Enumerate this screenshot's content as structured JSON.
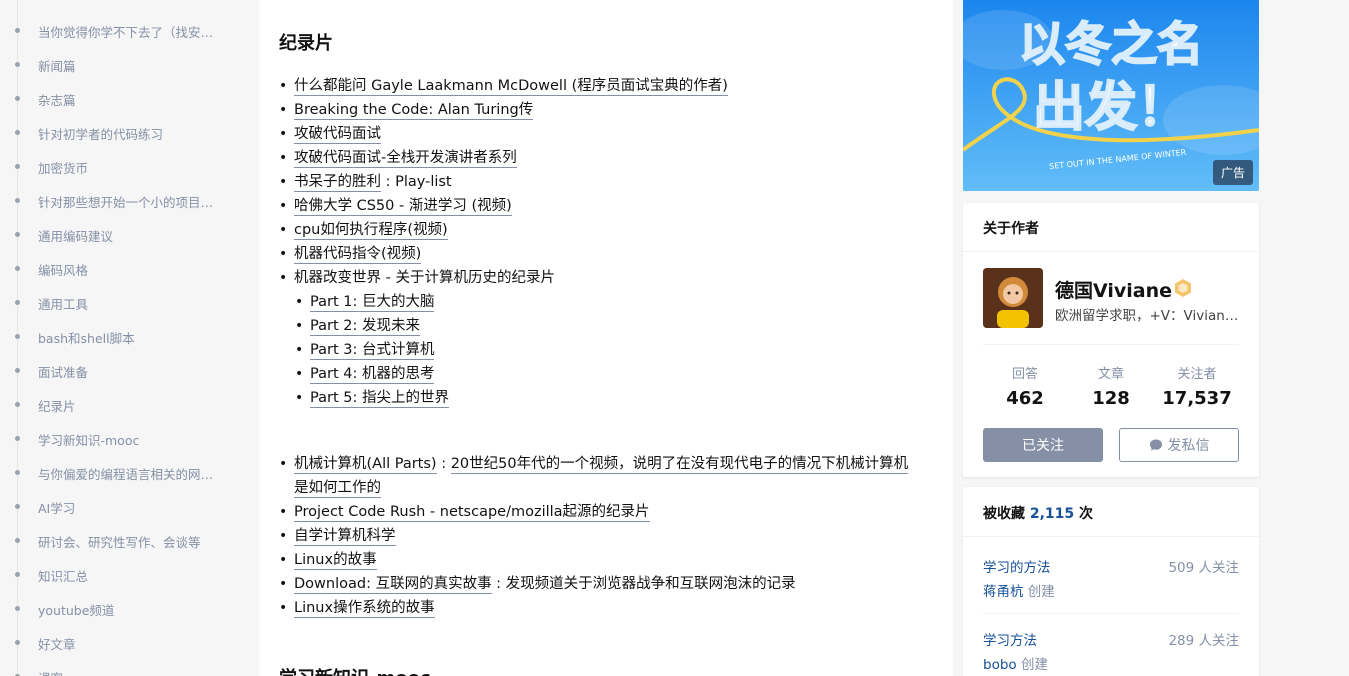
{
  "catalog": {
    "items": [
      {
        "label": "当你觉得你学不下去了（找安慰..."
      },
      {
        "label": "新闻篇"
      },
      {
        "label": "杂志篇"
      },
      {
        "label": "针对初学者的代码练习"
      },
      {
        "label": "加密货币"
      },
      {
        "label": "针对那些想开始一个小的项目但..."
      },
      {
        "label": "通用编码建议"
      },
      {
        "label": "编码风格"
      },
      {
        "label": "通用工具"
      },
      {
        "label": "bash和shell脚本"
      },
      {
        "label": "面试准备"
      },
      {
        "label": "纪录片"
      },
      {
        "label": "学习新知识-mooc"
      },
      {
        "label": "与你偏爱的编程语言相关的网站..."
      },
      {
        "label": "AI学习"
      },
      {
        "label": "研讨会、研究性写作、会谈等"
      },
      {
        "label": "知识汇总"
      },
      {
        "label": "youtube频道"
      },
      {
        "label": "好文章"
      },
      {
        "label": "课客"
      }
    ]
  },
  "article": {
    "section_title": "纪录片",
    "next_section_title": "学习新知识-mooc",
    "list1": [
      {
        "link": "什么都能问 Gayle Laakmann McDowell (程序员面试宝典的作者)",
        "rest": ""
      },
      {
        "link": "Breaking the Code: Alan Turing传",
        "rest": ""
      },
      {
        "link": "攻破代码面试",
        "rest": ""
      },
      {
        "link": "攻破代码面试-全栈开发演讲者系列",
        "rest": ""
      },
      {
        "link": "书呆子的胜利",
        "rest": " : Play-list"
      },
      {
        "link": "哈佛大学 CS50 - 渐进学习 (视频)",
        "rest": ""
      },
      {
        "link": "cpu如何执行程序(视频)",
        "rest": ""
      },
      {
        "link": "机器代码指令(视频)",
        "rest": ""
      }
    ],
    "list1_text_item": "机器改变世界 - 关于计算机历史的纪录片",
    "sublist": [
      {
        "link": "Part 1: 巨大的大脑"
      },
      {
        "link": "Part 2: 发现未来"
      },
      {
        "link": "Part 3: 台式计算机"
      },
      {
        "link": "Part 4: 机器的思考"
      },
      {
        "link": "Part 5: 指尖上的世界"
      }
    ],
    "list2_first": {
      "link": "机械计算机(All Parts)",
      "rest": " : ",
      "link2a": "20世纪50年代的一个视频，说明了在没有现代电子的情况下机械计算机",
      "link2b": "是如何工作的"
    },
    "list2": [
      {
        "link": "Project Code Rush - netscape/mozilla起源的纪录片",
        "rest": ""
      },
      {
        "link": "自学计算机科学",
        "rest": ""
      },
      {
        "link": "Linux的故事",
        "rest": ""
      },
      {
        "link": "Download: 互联网的真实故事",
        "rest": " : 发现频道关于浏览器战争和互联网泡沫的记录"
      },
      {
        "link": "Linux操作系统的故事",
        "rest": ""
      }
    ]
  },
  "ad": {
    "tag": "广告",
    "headline_line1": "以冬之名",
    "headline_line2": "出发！",
    "tagline": "SET OUT IN THE NAME OF WINTER"
  },
  "author_card": {
    "title": "关于作者",
    "name": "德国Viviane",
    "bio": "欧洲留学求职，+V：Viviane...",
    "stats": [
      {
        "label": "回答",
        "value": "462"
      },
      {
        "label": "文章",
        "value": "128"
      },
      {
        "label": "关注者",
        "value": "17,537"
      }
    ],
    "followed_label": "已关注",
    "message_label": "发私信"
  },
  "favorites_card": {
    "prefix": "被收藏 ",
    "count": "2,115",
    "suffix": " 次",
    "collections": [
      {
        "name": "学习的方法",
        "followers": "509 人关注",
        "creator": "蒋甬杭",
        "creator_suffix": " 创建"
      },
      {
        "name": "学习方法",
        "followers": "289 人关注",
        "creator": "bobo",
        "creator_suffix": " 创建"
      }
    ]
  }
}
